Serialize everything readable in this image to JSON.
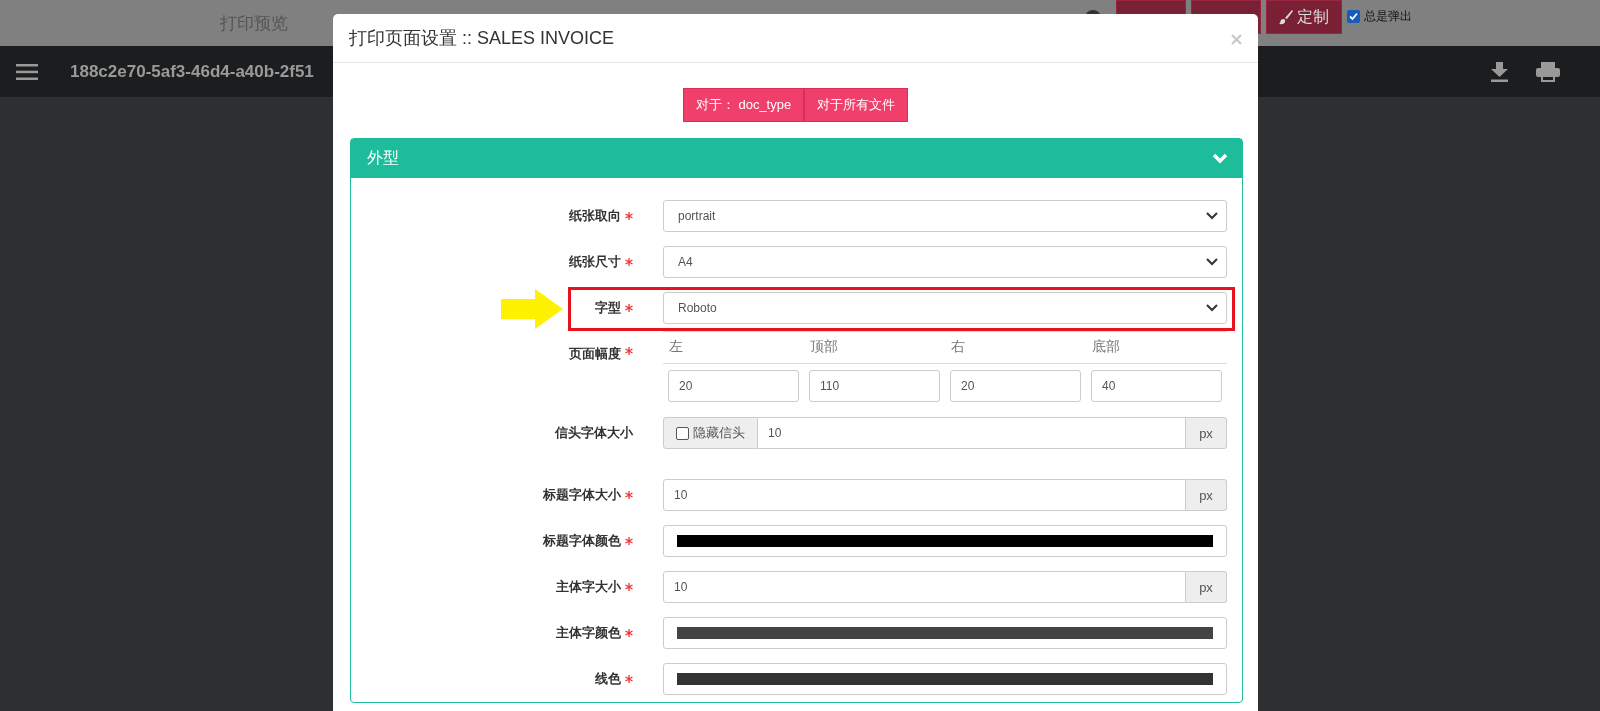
{
  "page": {
    "title": "打印预览",
    "document_id": "188c2e70-5af3-46d4-a40b-2f51",
    "customize_button": "定制",
    "always_popup": {
      "label": "总是弹出",
      "checked": true
    }
  },
  "dialog": {
    "title": "打印页面设置 :: SALES INVOICE",
    "scope_buttons": [
      "对于： doc_type",
      "对于所有文件"
    ],
    "section": {
      "title": "外型",
      "expanded": true,
      "fields": [
        {
          "kind": "select",
          "label": "纸张取向",
          "required": true,
          "value": "portrait",
          "highlighted": false
        },
        {
          "kind": "select",
          "label": "纸张尺寸",
          "required": true,
          "value": "A4",
          "highlighted": false
        },
        {
          "kind": "select",
          "label": "字型",
          "required": true,
          "value": "Roboto",
          "highlighted": true
        },
        {
          "kind": "margins",
          "label": "页面幅度",
          "required": true,
          "columns": [
            {
              "label": "左",
              "value": "20"
            },
            {
              "label": "顶部",
              "value": "110"
            },
            {
              "label": "右",
              "value": "20"
            },
            {
              "label": "底部",
              "value": "40"
            }
          ]
        },
        {
          "kind": "letterhead",
          "label": "信头字体大小",
          "required": false,
          "checkbox": {
            "label": "隐藏信头",
            "checked": false
          },
          "value": "10",
          "unit": "px"
        },
        {
          "kind": "number",
          "label": "标题字体大小",
          "required": true,
          "value": "10",
          "unit": "px"
        },
        {
          "kind": "color",
          "label": "标题字体颜色",
          "required": true,
          "color": "#000000"
        },
        {
          "kind": "number",
          "label": "主体字大小",
          "required": true,
          "value": "10",
          "unit": "px"
        },
        {
          "kind": "color",
          "label": "主体字颜色",
          "required": true,
          "color": "#444444"
        },
        {
          "kind": "color",
          "label": "线色",
          "required": true,
          "color": "#333333"
        }
      ]
    }
  }
}
